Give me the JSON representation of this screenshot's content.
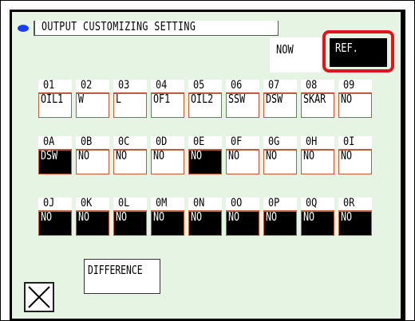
{
  "title": "OUTPUT CUSTOMIZING SETTING",
  "now_label": "NOW",
  "ref_label": "REF.",
  "difference_label": "DIFFERENCE",
  "close_icon": "close-x-icon",
  "colors": {
    "panel_bg": "#e6f5e3",
    "highlight": "#e1141e",
    "dot": "#1a3cff"
  },
  "rows": [
    [
      {
        "code": "01",
        "value": "OIL1",
        "selected": false
      },
      {
        "code": "02",
        "value": "W",
        "selected": false
      },
      {
        "code": "03",
        "value": "L",
        "selected": false
      },
      {
        "code": "04",
        "value": "OF1",
        "selected": false
      },
      {
        "code": "05",
        "value": "OIL2",
        "selected": false
      },
      {
        "code": "06",
        "value": "SSW",
        "selected": false
      },
      {
        "code": "07",
        "value": "DSW",
        "selected": false
      },
      {
        "code": "08",
        "value": "SKAR",
        "selected": false
      },
      {
        "code": "09",
        "value": "NO",
        "selected": false
      }
    ],
    [
      {
        "code": "0A",
        "value": "DSW",
        "selected": true
      },
      {
        "code": "0B",
        "value": "NO",
        "selected": false
      },
      {
        "code": "0C",
        "value": "NO",
        "selected": false
      },
      {
        "code": "0D",
        "value": "NO",
        "selected": false
      },
      {
        "code": "0E",
        "value": "NO",
        "selected": true
      },
      {
        "code": "0F",
        "value": "NO",
        "selected": false
      },
      {
        "code": "0G",
        "value": "NO",
        "selected": false
      },
      {
        "code": "0H",
        "value": "NO",
        "selected": false
      },
      {
        "code": "0I",
        "value": "NO",
        "selected": false
      }
    ],
    [
      {
        "code": "0J",
        "value": "NO",
        "selected": true
      },
      {
        "code": "0K",
        "value": "NO",
        "selected": true
      },
      {
        "code": "0L",
        "value": "NO",
        "selected": true
      },
      {
        "code": "0M",
        "value": "NO",
        "selected": true
      },
      {
        "code": "0N",
        "value": "NO",
        "selected": true
      },
      {
        "code": "0O",
        "value": "NO",
        "selected": true
      },
      {
        "code": "0P",
        "value": "NO",
        "selected": true
      },
      {
        "code": "0Q",
        "value": "NO",
        "selected": true
      },
      {
        "code": "0R",
        "value": "NO",
        "selected": true
      }
    ]
  ]
}
